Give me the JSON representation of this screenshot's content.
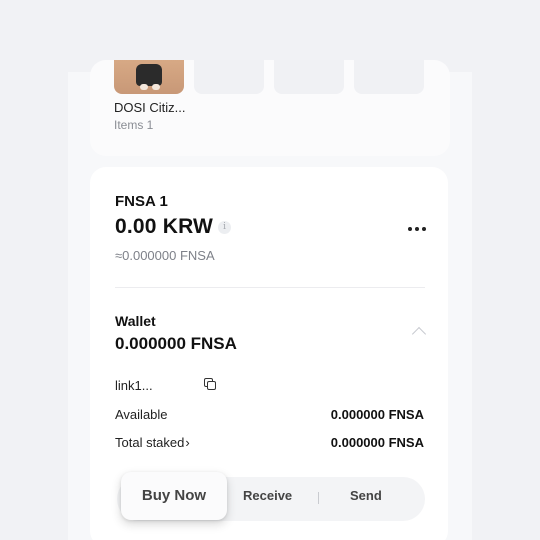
{
  "nft": {
    "name": "DOSI Citiz...",
    "items": "Items 1"
  },
  "token": {
    "name": "FNSA 1",
    "balance": "0.00 KRW",
    "info_icon": "i",
    "approx": "≈0.000000 FNSA"
  },
  "wallet": {
    "label": "Wallet",
    "balance": "0.000000 FNSA",
    "address": "link1...",
    "available_label": "Available",
    "available_value": "0.000000 FNSA",
    "staked_label": "Total staked",
    "staked_arrow": "›",
    "staked_value": "0.000000 FNSA"
  },
  "actions": {
    "buy": "Buy Now",
    "receive": "Receive",
    "send": "Send"
  }
}
